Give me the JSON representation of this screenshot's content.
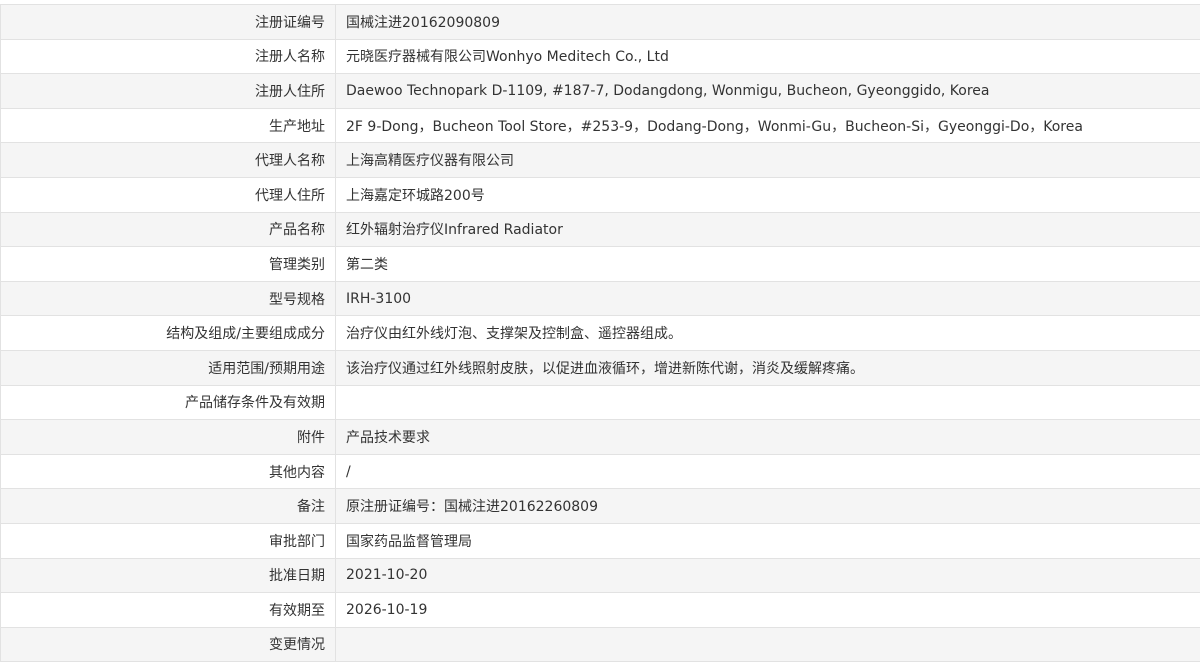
{
  "rows": [
    {
      "label": "注册证编号",
      "value": "国械注进20162090809"
    },
    {
      "label": "注册人名称",
      "value": "元晓医疗器械有限公司Wonhyo Meditech Co., Ltd"
    },
    {
      "label": "注册人住所",
      "value": "Daewoo Technopark D-1109, #187-7, Dodangdong, Wonmigu, Bucheon, Gyeonggido, Korea"
    },
    {
      "label": "生产地址",
      "value": "2F 9-Dong，Bucheon Tool Store，#253-9，Dodang-Dong，Wonmi-Gu，Bucheon-Si，Gyeonggi-Do，Korea"
    },
    {
      "label": "代理人名称",
      "value": "上海高精医疗仪器有限公司"
    },
    {
      "label": "代理人住所",
      "value": "上海嘉定环城路200号"
    },
    {
      "label": "产品名称",
      "value": "红外辐射治疗仪Infrared Radiator"
    },
    {
      "label": "管理类别",
      "value": "第二类"
    },
    {
      "label": "型号规格",
      "value": "IRH-3100"
    },
    {
      "label": "结构及组成/主要组成成分",
      "value": "治疗仪由红外线灯泡、支撑架及控制盒、遥控器组成。"
    },
    {
      "label": "适用范围/预期用途",
      "value": "该治疗仪通过红外线照射皮肤，以促进血液循环，增进新陈代谢，消炎及缓解疼痛。"
    },
    {
      "label": "产品储存条件及有效期",
      "value": ""
    },
    {
      "label": "附件",
      "value": "产品技术要求"
    },
    {
      "label": "其他内容",
      "value": "/"
    },
    {
      "label": "备注",
      "value": "原注册证编号：国械注进20162260809"
    },
    {
      "label": "审批部门",
      "value": "国家药品监督管理局"
    },
    {
      "label": "批准日期",
      "value": "2021-10-20"
    },
    {
      "label": "有效期至",
      "value": "2026-10-19"
    },
    {
      "label": "变更情况",
      "value": ""
    }
  ]
}
